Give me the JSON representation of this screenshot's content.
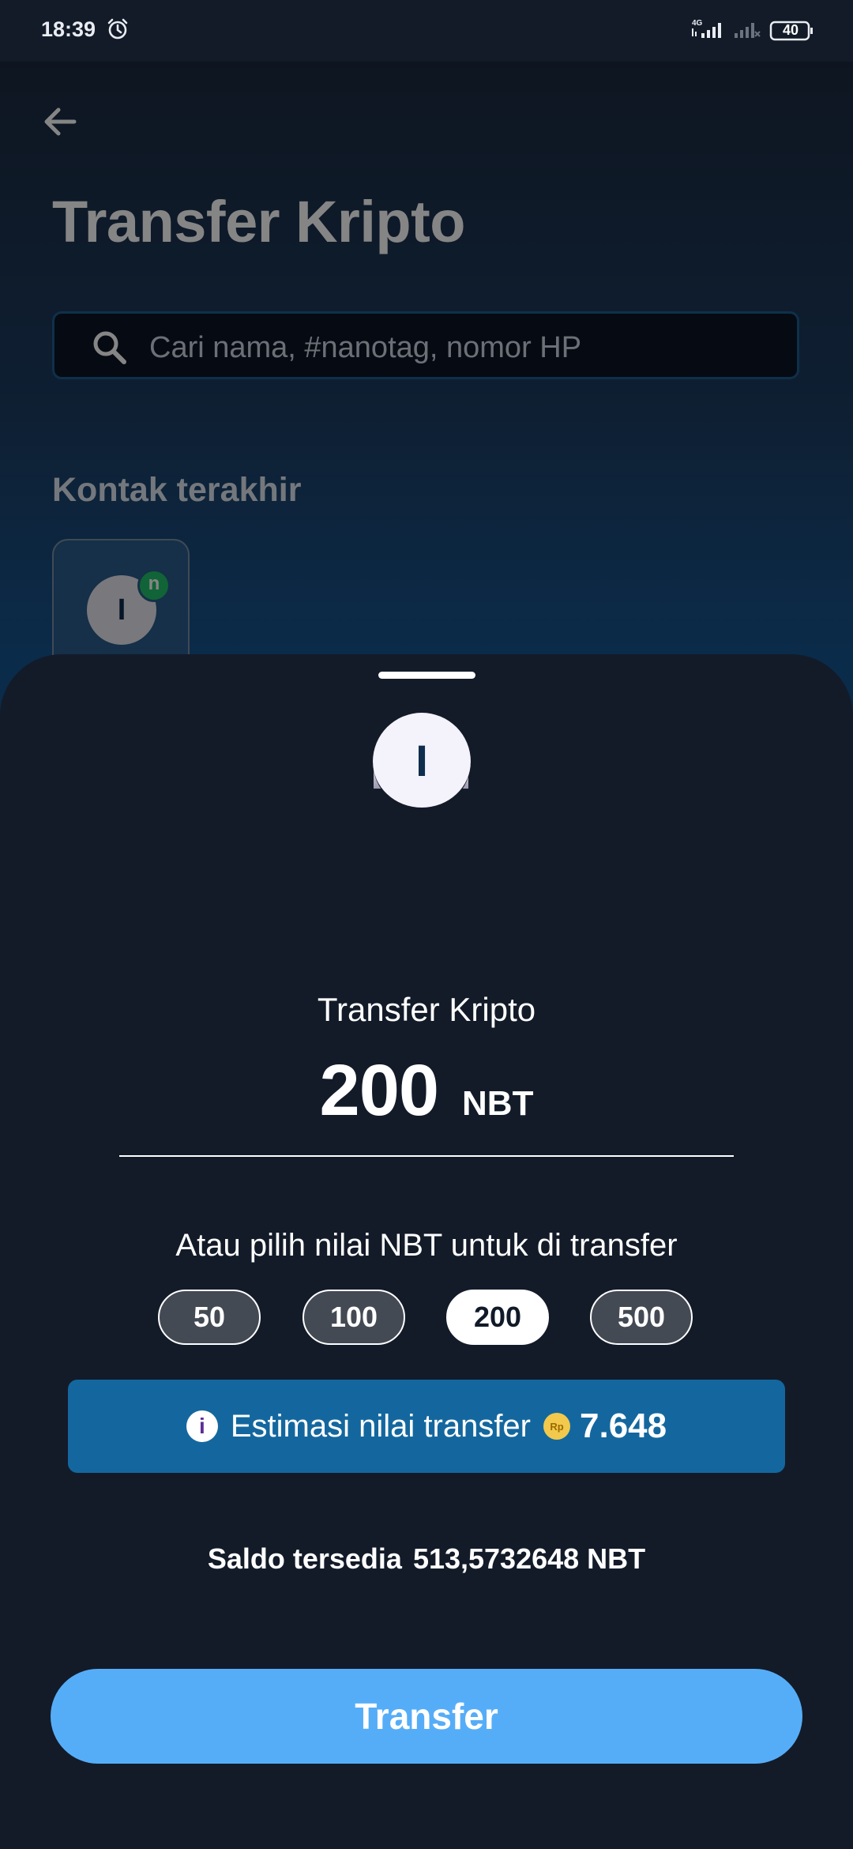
{
  "status_bar": {
    "time": "18:39",
    "network": "4G",
    "battery": "40"
  },
  "background_page": {
    "title": "Transfer Kripto",
    "search": {
      "placeholder": "Cari nama, #nanotag, nomor HP",
      "value": ""
    },
    "recent_section_title": "Kontak terakhir",
    "recent_contacts": [
      {
        "initial": "I",
        "badge": "n"
      }
    ]
  },
  "sheet": {
    "recipient_initial": "I",
    "title": "Transfer Kripto",
    "amount": "200",
    "unit": "NBT",
    "quick_pick_label": "Atau pilih nilai NBT untuk di transfer",
    "quick_amounts": [
      {
        "label": "50",
        "selected": false
      },
      {
        "label": "100",
        "selected": false
      },
      {
        "label": "200",
        "selected": true
      },
      {
        "label": "500",
        "selected": false
      }
    ],
    "estimate": {
      "info_glyph": "i",
      "label": "Estimasi nilai transfer",
      "currency_glyph": "Rp",
      "value": "7.648"
    },
    "balance_label": "Saldo tersedia",
    "balance_value": "513,5732648 NBT",
    "transfer_button": "Transfer"
  },
  "colors": {
    "sheet_bg": "#131b29",
    "accent_button": "#56adf7",
    "estimate_bg": "#14679e",
    "badge_green": "#22c06a"
  }
}
